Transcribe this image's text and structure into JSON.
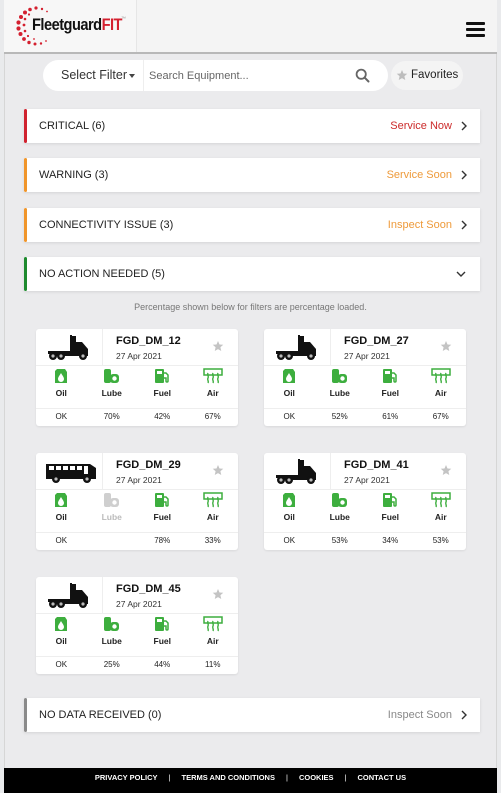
{
  "header": {
    "logo_main": "Fleetguard",
    "logo_accent": "FIT",
    "logo_tm": "™",
    "menu_icon": "hamburger-icon"
  },
  "search": {
    "filter_label": "Select Filter",
    "placeholder": "Search Equipment...",
    "value": "",
    "search_icon": "magnifier-icon",
    "favorites_label": "Favorites"
  },
  "status_groups": [
    {
      "label": "CRITICAL (6)",
      "action": "Service Now",
      "color": "#d0222f",
      "expanded": false
    },
    {
      "label": "WARNING (3)",
      "action": "Service Soon",
      "color": "#f0952a",
      "expanded": false
    },
    {
      "label": "CONNECTIVITY ISSUE (3)",
      "action": "Inspect Soon",
      "color": "#f0952a",
      "expanded": false
    },
    {
      "label": "NO ACTION NEEDED (5)",
      "action": "",
      "color": "#1e8a2e",
      "expanded": true
    },
    {
      "label": "NO DATA RECEIVED (0)",
      "action": "Inspect Soon",
      "color": "#8a8a8a",
      "expanded": false
    }
  ],
  "colors": {
    "filter_green": "#3dae3e",
    "disabled_gray": "#cfcfcf",
    "action_critical": "#cc2b2b",
    "action_warning": "#ee9a3a",
    "action_nodata": "#888888"
  },
  "note": "Percentage shown below for filters are percentage loaded.",
  "filter_labels": [
    "Oil",
    "Lube",
    "Fuel",
    "Air"
  ],
  "equipment": [
    {
      "name": "FGD_DM_12",
      "date": "27 Apr 2021",
      "vehicle": "truck",
      "values": [
        "OK",
        "70%",
        "42%",
        "67%"
      ],
      "disabled": [
        false,
        false,
        false,
        false
      ]
    },
    {
      "name": "FGD_DM_27",
      "date": "27 Apr 2021",
      "vehicle": "truck",
      "values": [
        "OK",
        "52%",
        "61%",
        "67%"
      ],
      "disabled": [
        false,
        false,
        false,
        false
      ]
    },
    {
      "name": "FGD_DM_29",
      "date": "27 Apr 2021",
      "vehicle": "bus",
      "values": [
        "OK",
        "",
        "78%",
        "33%"
      ],
      "disabled": [
        false,
        true,
        false,
        false
      ]
    },
    {
      "name": "FGD_DM_41",
      "date": "27 Apr 2021",
      "vehicle": "truck",
      "values": [
        "OK",
        "53%",
        "34%",
        "53%"
      ],
      "disabled": [
        false,
        false,
        false,
        false
      ]
    },
    {
      "name": "FGD_DM_45",
      "date": "27 Apr 2021",
      "vehicle": "truck",
      "values": [
        "OK",
        "25%",
        "44%",
        "11%"
      ],
      "disabled": [
        false,
        false,
        false,
        false
      ]
    }
  ],
  "footer": {
    "links": [
      "PRIVACY POLICY",
      "TERMS AND CONDITIONS",
      "COOKIES",
      "CONTACT US"
    ],
    "separator": "|"
  }
}
